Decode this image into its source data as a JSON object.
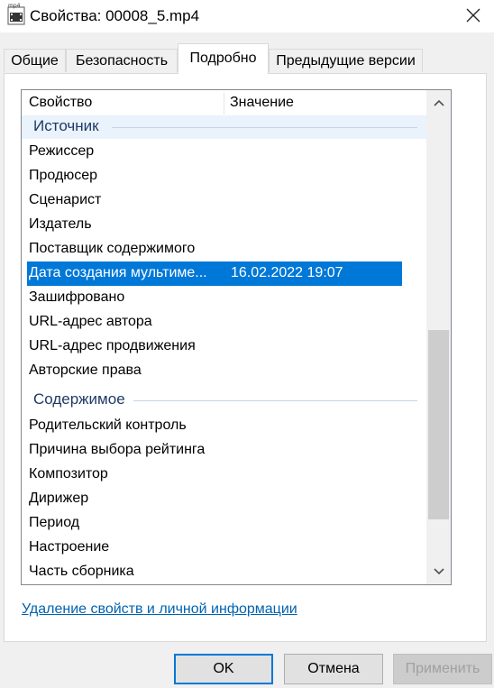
{
  "window": {
    "title": "Свойства: 00008_5.mp4",
    "icon": "video-file-icon",
    "icon_badge": "mp4",
    "close_icon": "close-icon"
  },
  "tabs": [
    {
      "label": "Общие",
      "active": false
    },
    {
      "label": "Безопасность",
      "active": false
    },
    {
      "label": "Подробно",
      "active": true
    },
    {
      "label": "Предыдущие версии",
      "active": false
    }
  ],
  "list": {
    "header": {
      "property": "Свойство",
      "value": "Значение"
    },
    "groups": [
      {
        "label": "Источник"
      },
      {
        "label": "Содержимое"
      }
    ],
    "rows": [
      {
        "property": "Режиссер",
        "value": ""
      },
      {
        "property": "Продюсер",
        "value": ""
      },
      {
        "property": "Сценарист",
        "value": ""
      },
      {
        "property": "Издатель",
        "value": ""
      },
      {
        "property": "Поставщик содержимого",
        "value": ""
      },
      {
        "property": "Дата создания мультиме...",
        "value": "16.02.2022 19:07",
        "selected": true
      },
      {
        "property": "Зашифровано",
        "value": ""
      },
      {
        "property": "URL-адрес автора",
        "value": ""
      },
      {
        "property": "URL-адрес продвижения",
        "value": ""
      },
      {
        "property": "Авторские права",
        "value": ""
      },
      {
        "property": "Родительский контроль",
        "value": ""
      },
      {
        "property": "Причина выбора рейтинга",
        "value": ""
      },
      {
        "property": "Композитор",
        "value": ""
      },
      {
        "property": "Дирижер",
        "value": ""
      },
      {
        "property": "Период",
        "value": ""
      },
      {
        "property": "Настроение",
        "value": ""
      },
      {
        "property": "Часть сборника",
        "value": ""
      }
    ]
  },
  "link": {
    "remove_properties": "Удаление свойств и личной информации"
  },
  "buttons": {
    "ok": "OK",
    "cancel": "Отмена",
    "apply": "Применить"
  },
  "colors": {
    "selection": "#0078d7",
    "link": "#0063b1",
    "group_text": "#1e3a64"
  }
}
